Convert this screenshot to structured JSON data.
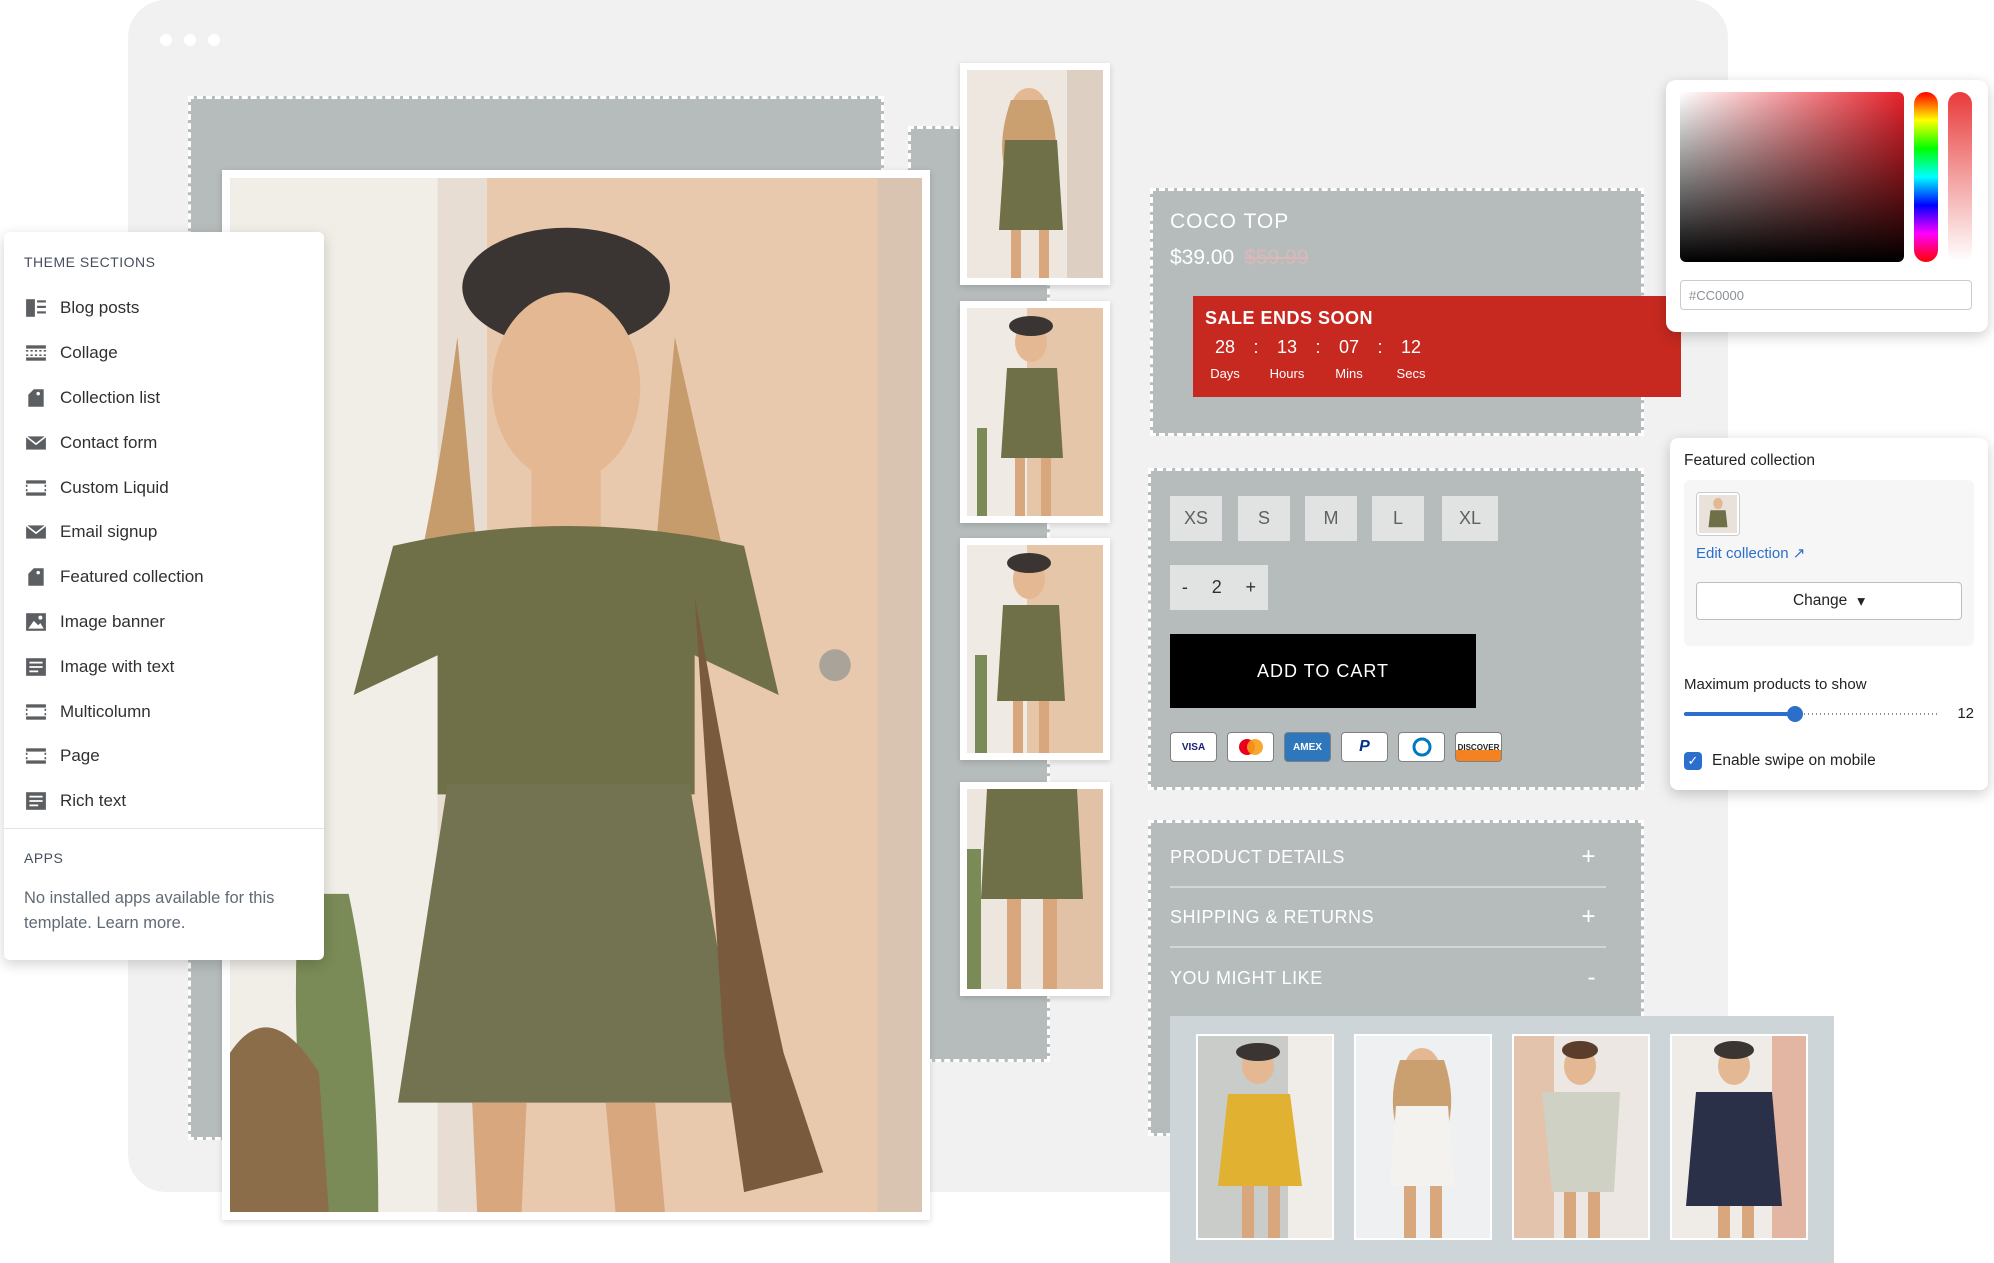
{
  "theme_sections": {
    "heading": "THEME SECTIONS",
    "items": [
      {
        "label": "Blog posts",
        "icon": "blog-icon"
      },
      {
        "label": "Collage",
        "icon": "collage-icon"
      },
      {
        "label": "Collection list",
        "icon": "tag-icon"
      },
      {
        "label": "Contact form",
        "icon": "envelope-icon"
      },
      {
        "label": "Custom Liquid",
        "icon": "dashed-box-icon"
      },
      {
        "label": "Email signup",
        "icon": "envelope-icon"
      },
      {
        "label": "Featured collection",
        "icon": "tag-icon"
      },
      {
        "label": "Image banner",
        "icon": "image-icon"
      },
      {
        "label": "Image with text",
        "icon": "text-block-icon"
      },
      {
        "label": "Multicolumn",
        "icon": "dashed-box-icon"
      },
      {
        "label": "Page",
        "icon": "dashed-box-icon"
      },
      {
        "label": "Rich text",
        "icon": "text-block-icon"
      }
    ],
    "apps_heading": "APPS",
    "apps_text": "No installed apps available for this template. Learn more."
  },
  "product": {
    "title": "COCO TOP",
    "price": "$39.00",
    "compare_price": "$59.99",
    "sale": {
      "heading": "SALE ENDS SOON",
      "countdown": [
        {
          "value": "28",
          "label": "Days"
        },
        {
          "value": "13",
          "label": "Hours"
        },
        {
          "value": "07",
          "label": "Mins"
        },
        {
          "value": "12",
          "label": "Secs"
        }
      ],
      "separator": ":",
      "color": "#C72920"
    },
    "sizes": [
      "XS",
      "S",
      "M",
      "L",
      "XL"
    ],
    "quantity": {
      "minus": "-",
      "value": "2",
      "plus": "+"
    },
    "add_to_cart": "ADD TO CART",
    "payments": [
      "VISA",
      "Mastercard",
      "AMEX",
      "PayPal",
      "Diners",
      "DISCOVER"
    ],
    "accordion": [
      {
        "label": "PRODUCT DETAILS",
        "sign": "+"
      },
      {
        "label": "SHIPPING & RETURNS",
        "sign": "+"
      },
      {
        "label": "YOU MIGHT LIKE",
        "sign": "-"
      }
    ]
  },
  "color_picker": {
    "hex_value": "#CC0000"
  },
  "featured_collection": {
    "heading": "Featured collection",
    "edit_link": "Edit collection",
    "change_button": "Change",
    "max_products_label": "Maximum products to show",
    "max_products_value": "12",
    "max_products_range": [
      2,
      25
    ],
    "swipe_label": "Enable swipe on mobile",
    "swipe_checked": true,
    "accent_color": "#2C6ECB"
  }
}
